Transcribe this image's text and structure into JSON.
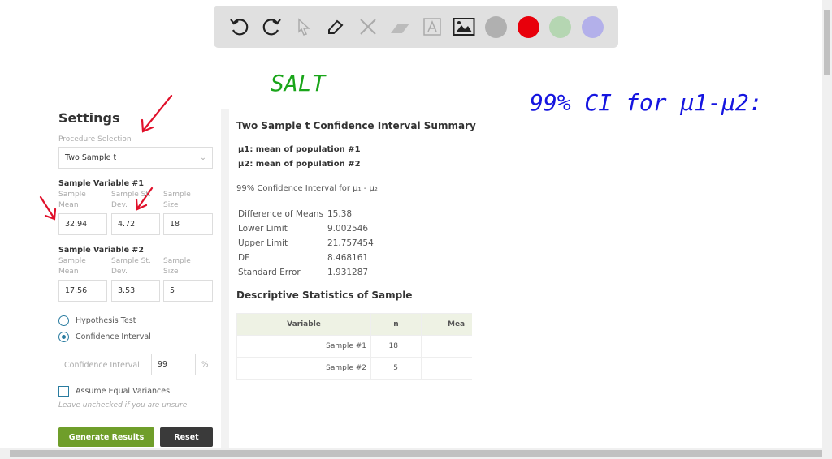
{
  "toolbar": {
    "tools": [
      "undo-icon",
      "redo-icon",
      "pointer-icon",
      "pen-icon",
      "tools-icon",
      "eraser-icon",
      "text-icon",
      "image-icon"
    ],
    "colors": [
      "#b0b0b0",
      "#e8000b",
      "#b5d6b2",
      "#b3b0ea"
    ]
  },
  "annotations": {
    "salt": "SALT",
    "ci_note": "99% CI for μ1-μ2:"
  },
  "settings": {
    "title": "Settings",
    "procedure_label": "Procedure Selection",
    "procedure_value": "Two Sample t",
    "var1": {
      "title": "Sample Variable #1",
      "mean_label": "Sample Mean",
      "sd_label": "Sample St. Dev.",
      "size_label": "Sample Size",
      "mean": "32.94",
      "sd": "4.72",
      "size": "18"
    },
    "var2": {
      "title": "Sample Variable #2",
      "mean_label": "Sample Mean",
      "sd_label": "Sample St. Dev.",
      "size_label": "Sample Size",
      "mean": "17.56",
      "sd": "3.53",
      "size": "5"
    },
    "hypothesis_test": "Hypothesis Test",
    "confidence_interval": "Confidence Interval",
    "ci_label": "Confidence Interval",
    "ci_value": "99",
    "ci_unit": "%",
    "equal_var": "Assume Equal Variances",
    "equal_var_hint": "Leave unchecked if you are unsure",
    "generate": "Generate Results",
    "reset": "Reset"
  },
  "results": {
    "title": "Two Sample t Confidence Interval Summary",
    "mu1": "μ1: mean of population #1",
    "mu2": "μ2: mean of population #2",
    "ci_heading": "99% Confidence Interval for μ₁ - μ₂",
    "rows": [
      {
        "k": "Difference of Means",
        "v": "15.38"
      },
      {
        "k": "Lower Limit",
        "v": "9.002546"
      },
      {
        "k": "Upper Limit",
        "v": "21.757454"
      },
      {
        "k": "DF",
        "v": "8.468161"
      },
      {
        "k": "Standard Error",
        "v": "1.931287"
      }
    ],
    "desc_title": "Descriptive Statistics of Sample",
    "table_headers": [
      "Variable",
      "n",
      "Mea"
    ],
    "table_rows": [
      [
        "Sample #1",
        "18"
      ],
      [
        "Sample #2",
        "5"
      ]
    ]
  }
}
